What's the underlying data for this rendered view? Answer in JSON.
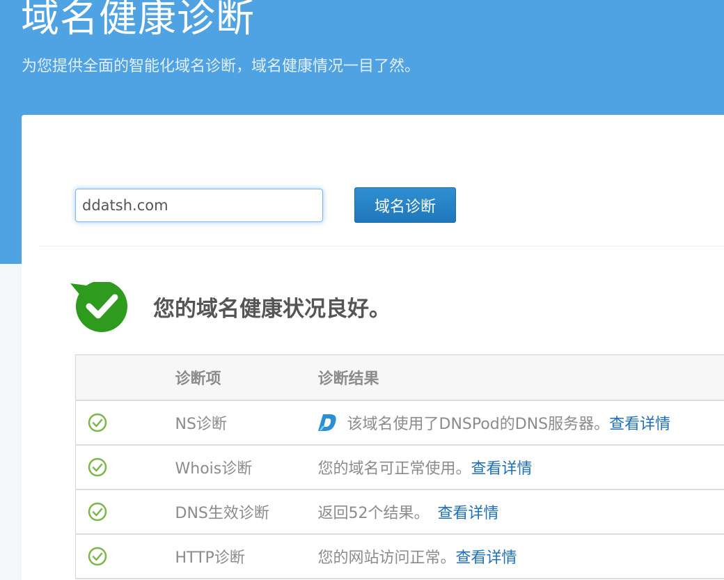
{
  "header": {
    "title": "域名健康诊断",
    "subtitle": "为您提供全面的智能化域名诊断，域名健康情况一目了然。"
  },
  "search": {
    "value": "ddatsh.com",
    "button_label": "域名诊断"
  },
  "summary": {
    "message": "您的域名健康状况良好。"
  },
  "table": {
    "columns": [
      "",
      "诊断项",
      "诊断结果"
    ],
    "rows": [
      {
        "status": "ok",
        "item": "NS诊断",
        "result": "该域名使用了DNSPod的DNS服务器。",
        "link": "查看详情"
      },
      {
        "status": "ok",
        "item": "Whois诊断",
        "result": "您的域名可正常使用。",
        "link": "查看详情"
      },
      {
        "status": "ok",
        "item": "DNS生效诊断",
        "result": "返回52个结果。",
        "link": "查看详情"
      },
      {
        "status": "ok",
        "item": "HTTP诊断",
        "result": "您的网站访问正常。",
        "link": "查看详情"
      }
    ]
  },
  "icons": {
    "status": "check-bubble-icon",
    "row_status": "check-circle-icon",
    "ns_provider": "dnspod-logo-icon"
  },
  "colors": {
    "hero_bg": "#4fa3e2",
    "button_bg": "#2582c6",
    "ok_green": "#2e9a1e",
    "row_check": "#7ab648",
    "link": "#1e6fb8"
  }
}
